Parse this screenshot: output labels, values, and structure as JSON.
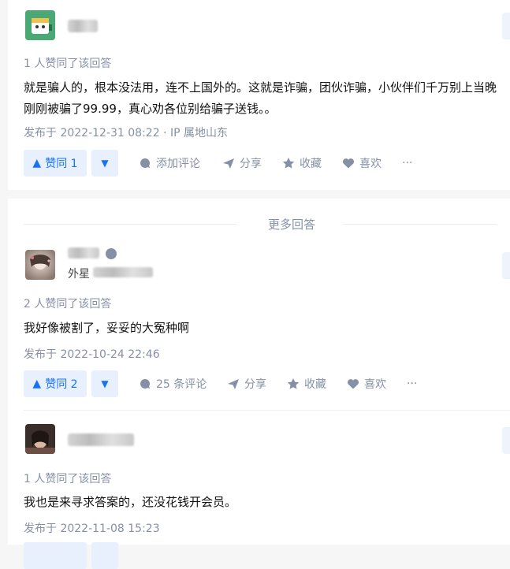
{
  "answers": [
    {
      "voters": "1 人赞同了该回答",
      "content": "就是骗人的，根本没法用，连不上国外的。这就是诈骗，团伙诈骗，小伙伴们千万别上当晚刚刚被骗了99.99，真心劝各位别给骗子送钱。。",
      "timestamp": "发布于 2022-12-31 08:22 · IP 属地山东",
      "vote_label": "赞同 1",
      "actions": [
        "添加评论",
        "分享",
        "收藏",
        "喜欢",
        "···"
      ]
    },
    {
      "author_sub": "外星",
      "voters": "2 人赞同了该回答",
      "content": "我好像被割了，妥妥的大冤种啊",
      "timestamp": "发布于 2022-10-24 22:46",
      "vote_label": "赞同 2",
      "actions": [
        "25 条评论",
        "分享",
        "收藏",
        "喜欢",
        "···"
      ]
    },
    {
      "voters": "1 人赞同了该回答",
      "content": "我也是来寻求答案的，还没花钱开会员。",
      "timestamp": "发布于 2022-11-08 15:23"
    }
  ],
  "divider": {
    "label": "更多回答"
  },
  "colors": {
    "accent": "#1772f6",
    "vote_bg": "#e8f0fd",
    "meta": "#8590a6"
  }
}
